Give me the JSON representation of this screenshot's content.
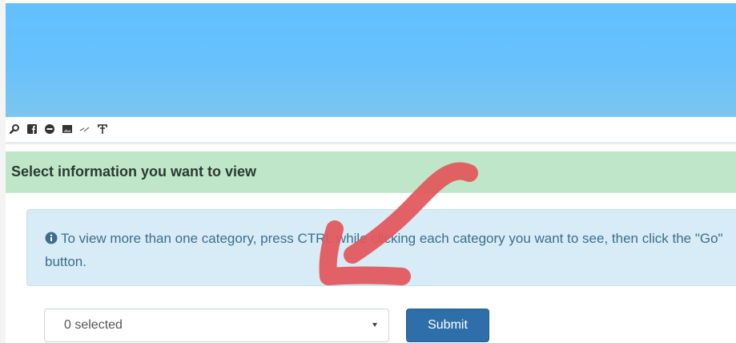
{
  "colors": {
    "banner": "#64c0fd",
    "section_header_bg": "#bfe6c8",
    "info_bg": "#d8ecf7",
    "info_text": "#3c6e8a",
    "submit_bg": "#2f6fa9",
    "annotation_arrow": "#e2565a"
  },
  "toolbar": {
    "icons": [
      "search-icon",
      "facebook-icon",
      "circle-icon",
      "image-icon",
      "link-icon",
      "text-icon"
    ]
  },
  "section": {
    "title": "Select information you want to view"
  },
  "info": {
    "icon": "info-circle-icon",
    "text": "To view more than one category, press CTRL while clicking each category you want to see, then click the \"Go\" button."
  },
  "form": {
    "select_value": "0 selected",
    "submit_label": "Submit"
  }
}
